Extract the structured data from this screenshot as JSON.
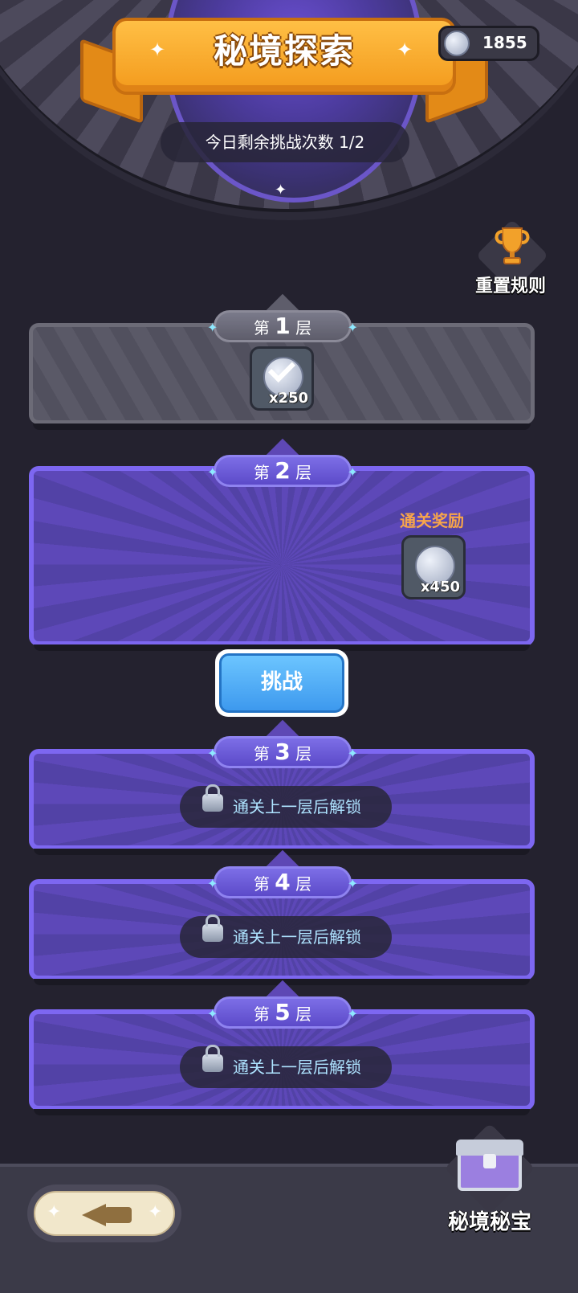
{
  "header": {
    "title": "秘境探索",
    "currency": {
      "icon": "star-coin-icon",
      "amount": "1855"
    },
    "remaining_challenges": "今日剩余挑战次数 1/2"
  },
  "rules_button": {
    "icon": "trophy-icon",
    "label": "重置规则"
  },
  "floors": [
    {
      "prefix": "第",
      "number": "1",
      "suffix": "层",
      "status": "completed",
      "reward_count": "x250"
    },
    {
      "prefix": "第",
      "number": "2",
      "suffix": "层",
      "status": "current",
      "reward_title": "通关奖励",
      "reward_count": "x450"
    },
    {
      "prefix": "第",
      "number": "3",
      "suffix": "层",
      "status": "locked",
      "lock_text": "通关上一层后解锁"
    },
    {
      "prefix": "第",
      "number": "4",
      "suffix": "层",
      "status": "locked",
      "lock_text": "通关上一层后解锁"
    },
    {
      "prefix": "第",
      "number": "5",
      "suffix": "层",
      "status": "locked",
      "lock_text": "通关上一层后解锁"
    }
  ],
  "challenge_button": {
    "label": "挑战"
  },
  "footer": {
    "back_icon": "back-arrow-icon",
    "chest_icon": "treasure-chest-icon",
    "chest_label": "秘境秘宝"
  },
  "colors": {
    "accent_orange": "#f39a1c",
    "floor_purple": "#7d67f1",
    "challenge_blue": "#3d99ee",
    "background": "#24222f"
  }
}
